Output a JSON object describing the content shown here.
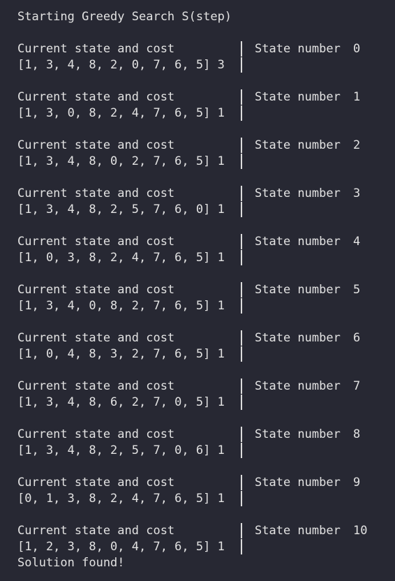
{
  "terminal": {
    "title": "Starting Greedy Search S(step)",
    "row_label": "Current state and cost",
    "state_label": "State number",
    "steps": [
      {
        "state": "[1, 3, 4, 8, 2, 0, 7, 6, 5]",
        "cost": "3",
        "number": "0"
      },
      {
        "state": "[1, 3, 0, 8, 2, 4, 7, 6, 5]",
        "cost": "1",
        "number": "1"
      },
      {
        "state": "[1, 3, 4, 8, 0, 2, 7, 6, 5]",
        "cost": "1",
        "number": "2"
      },
      {
        "state": "[1, 3, 4, 8, 2, 5, 7, 6, 0]",
        "cost": "1",
        "number": "3"
      },
      {
        "state": "[1, 0, 3, 8, 2, 4, 7, 6, 5]",
        "cost": "1",
        "number": "4"
      },
      {
        "state": "[1, 3, 4, 0, 8, 2, 7, 6, 5]",
        "cost": "1",
        "number": "5"
      },
      {
        "state": "[1, 0, 4, 8, 3, 2, 7, 6, 5]",
        "cost": "1",
        "number": "6"
      },
      {
        "state": "[1, 3, 4, 8, 6, 2, 7, 0, 5]",
        "cost": "1",
        "number": "7"
      },
      {
        "state": "[1, 3, 4, 8, 2, 5, 7, 0, 6]",
        "cost": "1",
        "number": "8"
      },
      {
        "state": "[0, 1, 3, 8, 2, 4, 7, 6, 5]",
        "cost": "1",
        "number": "9"
      },
      {
        "state": "[1, 2, 3, 8, 0, 4, 7, 6, 5]",
        "cost": "1",
        "number": "10"
      }
    ],
    "footer": "Solution found!"
  },
  "colors": {
    "background": "#272833",
    "text": "#e2e2e2"
  }
}
